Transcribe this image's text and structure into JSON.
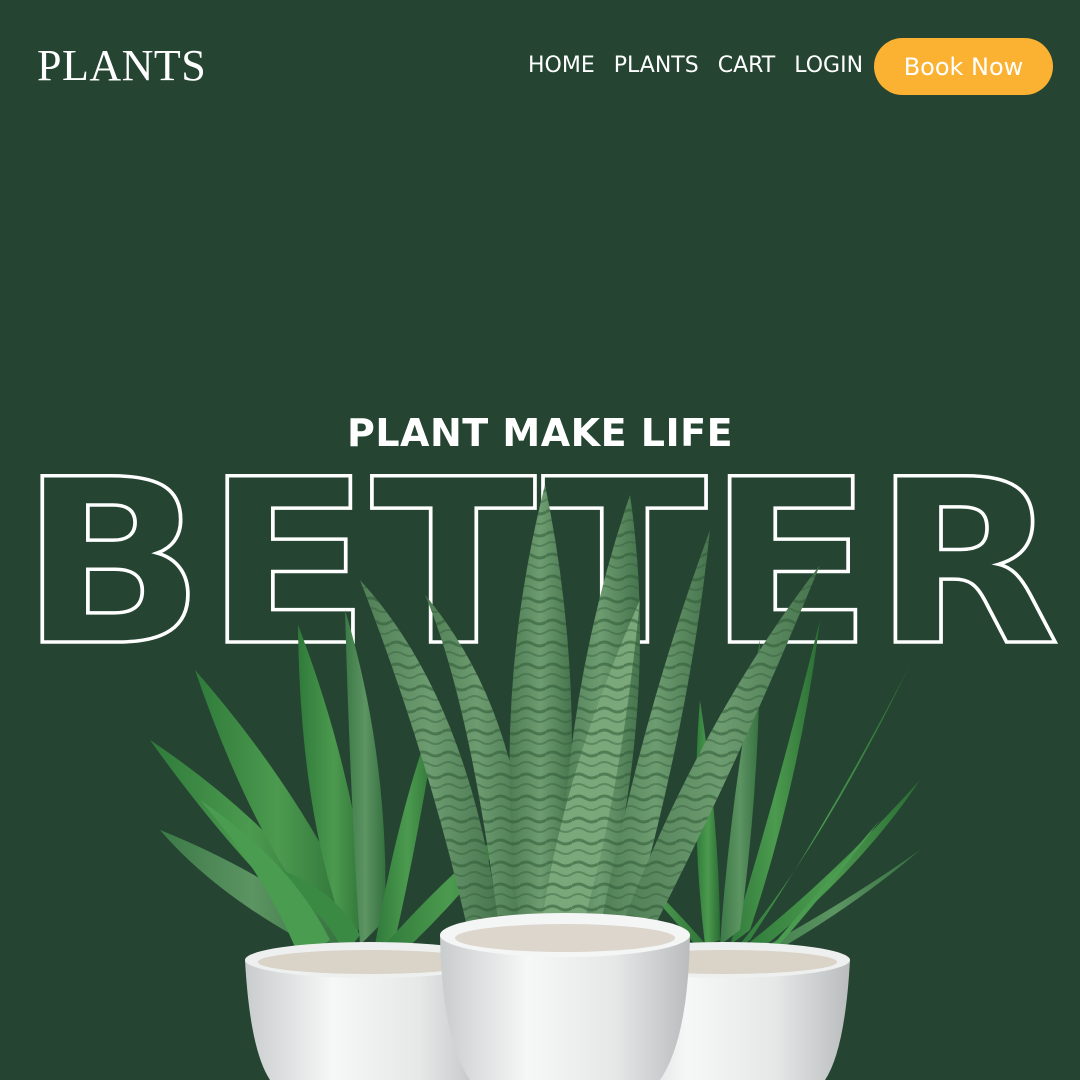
{
  "header": {
    "logo": "PLANTS",
    "nav": [
      "HOME",
      "PLANTS",
      "CART",
      "LOGIN"
    ],
    "cta_label": "Book Now"
  },
  "hero": {
    "subtitle": "PLANT MAKE LIFE",
    "headline": "BETTER"
  },
  "colors": {
    "background": "#254532",
    "accent": "#fbb131",
    "text": "#ffffff"
  },
  "image": {
    "description_icon": "potted-plants-illustration"
  }
}
